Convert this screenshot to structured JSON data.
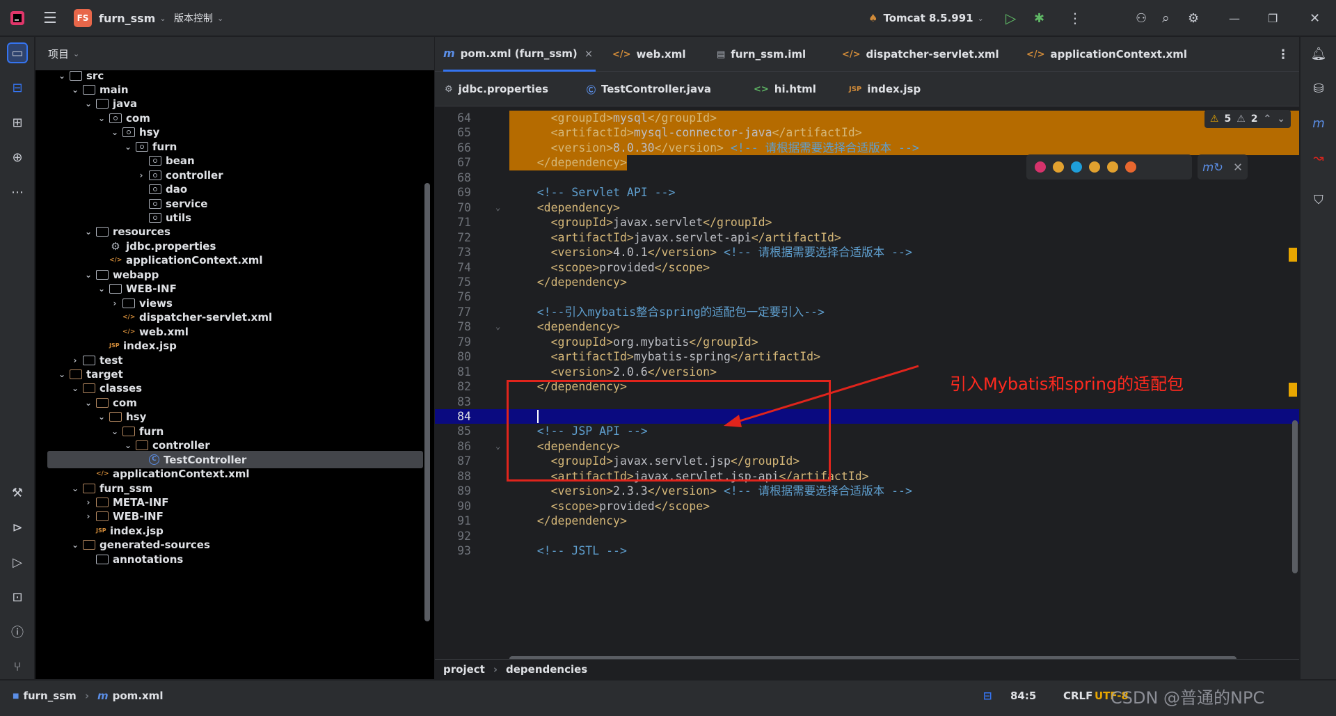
{
  "titlebar": {
    "project_badge": "FS",
    "project_name": "furn_ssm",
    "vcs": "版本控制",
    "run_config": "Tomcat 8.5.991"
  },
  "project_panel": {
    "title": "项目",
    "tree": [
      {
        "label": "src",
        "icon": "folder",
        "arrow": "⌄"
      },
      {
        "label": "main",
        "icon": "folder",
        "arrow": "⌄"
      },
      {
        "label": "java",
        "icon": "folder-source",
        "arrow": "⌄"
      },
      {
        "label": "com",
        "icon": "package",
        "arrow": "⌄"
      },
      {
        "label": "hsy",
        "icon": "package",
        "arrow": "⌄"
      },
      {
        "label": "furn",
        "icon": "package",
        "arrow": "⌄"
      },
      {
        "label": "bean",
        "icon": "package",
        "arrow": ""
      },
      {
        "label": "controller",
        "icon": "package",
        "arrow": "›"
      },
      {
        "label": "dao",
        "icon": "package",
        "arrow": ""
      },
      {
        "label": "service",
        "icon": "package",
        "arrow": ""
      },
      {
        "label": "utils",
        "icon": "package",
        "arrow": ""
      },
      {
        "label": "resources",
        "icon": "folder-resources",
        "arrow": "⌄"
      },
      {
        "label": "jdbc.properties",
        "icon": "gear",
        "arrow": ""
      },
      {
        "label": "applicationContext.xml",
        "icon": "xml",
        "arrow": ""
      },
      {
        "label": "webapp",
        "icon": "folder-web",
        "arrow": "⌄"
      },
      {
        "label": "WEB-INF",
        "icon": "folder",
        "arrow": "⌄"
      },
      {
        "label": "views",
        "icon": "folder",
        "arrow": "›"
      },
      {
        "label": "dispatcher-servlet.xml",
        "icon": "xml",
        "arrow": ""
      },
      {
        "label": "web.xml",
        "icon": "xml",
        "arrow": ""
      },
      {
        "label": "index.jsp",
        "icon": "jsp",
        "arrow": ""
      },
      {
        "label": "test",
        "icon": "folder",
        "arrow": "›"
      },
      {
        "label": "target",
        "icon": "folder-brown",
        "arrow": "⌄"
      },
      {
        "label": "classes",
        "icon": "folder-brown",
        "arrow": "⌄"
      },
      {
        "label": "com",
        "icon": "folder-brown",
        "arrow": "⌄"
      },
      {
        "label": "hsy",
        "icon": "folder-brown",
        "arrow": "⌄"
      },
      {
        "label": "furn",
        "icon": "folder-brown",
        "arrow": "⌄"
      },
      {
        "label": "controller",
        "icon": "folder-brown",
        "arrow": "⌄"
      },
      {
        "label": "TestController",
        "icon": "class",
        "arrow": ""
      },
      {
        "label": "applicationContext.xml",
        "icon": "xml",
        "arrow": ""
      },
      {
        "label": "furn_ssm",
        "icon": "folder-brown",
        "arrow": "⌄"
      },
      {
        "label": "META-INF",
        "icon": "folder-brown",
        "arrow": "›"
      },
      {
        "label": "WEB-INF",
        "icon": "folder-brown",
        "arrow": "›"
      },
      {
        "label": "index.jsp",
        "icon": "jsp",
        "arrow": ""
      },
      {
        "label": "generated-sources",
        "icon": "folder-brown",
        "arrow": "⌄"
      },
      {
        "label": "annotations",
        "icon": "folder-gen",
        "arrow": ""
      }
    ]
  },
  "tabs_row1": [
    {
      "label": "pom.xml (furn_ssm)",
      "icon": "m",
      "close": "×"
    },
    {
      "label": "web.xml",
      "icon": "xml"
    },
    {
      "label": "furn_ssm.iml",
      "icon": "iml"
    },
    {
      "label": "dispatcher-servlet.xml",
      "icon": "xml"
    },
    {
      "label": "applicationContext.xml",
      "icon": "xml"
    }
  ],
  "tabs_row2": [
    {
      "label": "jdbc.properties",
      "icon": "gear"
    },
    {
      "label": "TestController.java",
      "icon": "class"
    },
    {
      "label": "hi.html",
      "icon": "html"
    },
    {
      "label": "index.jsp",
      "icon": "jsp"
    }
  ],
  "inspections": {
    "warnings": "5",
    "weak_warnings": "2"
  },
  "code_lines": [
    {
      "n": "64",
      "html": "    <span class='tg'>&lt;groupId&gt;</span>mysql<span class='tg'>&lt;/groupId&gt;</span>"
    },
    {
      "n": "65",
      "html": "    <span class='tg'>&lt;artifactId&gt;</span>mysql-connector-java<span class='tg'>&lt;/artifactId&gt;</span>"
    },
    {
      "n": "66",
      "html": "    <span class='tg'>&lt;version&gt;</span>8.0.30<span class='tg'>&lt;/version&gt;</span> <span class='cm'>&lt;!-- 请根据需要选择合适版本 --&gt;</span>"
    },
    {
      "n": "67",
      "html": "  <span class='tg'>&lt;/dependency&gt;</span>"
    },
    {
      "n": "68",
      "html": ""
    },
    {
      "n": "69",
      "html": "  <span class='cm'>&lt;!-- Servlet API --&gt;</span>"
    },
    {
      "n": "70",
      "html": "  <span class='tg'>&lt;dependency&gt;</span>"
    },
    {
      "n": "71",
      "html": "    <span class='tg'>&lt;groupId&gt;</span>javax.servlet<span class='tg'>&lt;/groupId&gt;</span>"
    },
    {
      "n": "72",
      "html": "    <span class='tg'>&lt;artifactId&gt;</span>javax.servlet-api<span class='tg'>&lt;/artifactId&gt;</span>"
    },
    {
      "n": "73",
      "html": "    <span class='tg'>&lt;version&gt;</span>4.0.1<span class='tg'>&lt;/version&gt;</span> <span class='cm'>&lt;!-- 请根据需要选择合适版本 --&gt;</span>"
    },
    {
      "n": "74",
      "html": "    <span class='tg'>&lt;scope&gt;</span>provided<span class='tg'>&lt;/scope&gt;</span>"
    },
    {
      "n": "75",
      "html": "  <span class='tg'>&lt;/dependency&gt;</span>"
    },
    {
      "n": "76",
      "html": ""
    },
    {
      "n": "77",
      "html": "  <span class='cm'>&lt;!--引入mybatis整合spring的适配包一定要引入--&gt;</span>"
    },
    {
      "n": "78",
      "html": "  <span class='tg'>&lt;dependency&gt;</span>"
    },
    {
      "n": "79",
      "html": "    <span class='tg'>&lt;groupId&gt;</span>org.mybatis<span class='tg'>&lt;/groupId&gt;</span>"
    },
    {
      "n": "80",
      "html": "    <span class='tg'>&lt;artifactId&gt;</span>mybatis-spring<span class='tg'>&lt;/artifactId&gt;</span>"
    },
    {
      "n": "81",
      "html": "    <span class='tg'>&lt;version&gt;</span>2.0.6<span class='tg'>&lt;/version&gt;</span>"
    },
    {
      "n": "82",
      "html": "  <span class='tg'>&lt;/dependency&gt;</span>"
    },
    {
      "n": "83",
      "html": ""
    },
    {
      "n": "84",
      "html": "  <span style='border-left:2px solid #fff'>&#8203;</span>"
    },
    {
      "n": "85",
      "html": "  <span class='cm'>&lt;!-- JSP API --&gt;</span>"
    },
    {
      "n": "86",
      "html": "  <span class='tg'>&lt;dependency&gt;</span>"
    },
    {
      "n": "87",
      "html": "    <span class='tg'>&lt;groupId&gt;</span>javax.servlet.jsp<span class='tg'>&lt;/groupId&gt;</span>"
    },
    {
      "n": "88",
      "html": "    <span class='tg'>&lt;artifactId&gt;</span>javax.servlet.jsp-api<span class='tg'>&lt;/artifactId&gt;</span>"
    },
    {
      "n": "89",
      "html": "    <span class='tg'>&lt;version&gt;</span>2.3.3<span class='tg'>&lt;/version&gt;</span> <span class='cm'>&lt;!-- 请根据需要选择合适版本 --&gt;</span>"
    },
    {
      "n": "90",
      "html": "    <span class='tg'>&lt;scope&gt;</span>provided<span class='tg'>&lt;/scope&gt;</span>"
    },
    {
      "n": "91",
      "html": "  <span class='tg'>&lt;/dependency&gt;</span>"
    },
    {
      "n": "92",
      "html": ""
    },
    {
      "n": "93",
      "html": "  <span class='cm'>&lt;!-- JSTL --&gt;</span>"
    }
  ],
  "annotation": "引入Mybatis和spring的适配包",
  "breadcrumbs": [
    "project",
    "dependencies"
  ],
  "statusbar": {
    "path1": "furn_ssm",
    "path2": "pom.xml",
    "position": "84:5",
    "line_sep": "CRLF",
    "encoding": "UTF-8",
    "watermark": "CSDN @普通的NPC"
  },
  "colors": {
    "accent": "#3574f0",
    "highlight": "#b56b00",
    "annotation": "#e0241c"
  }
}
